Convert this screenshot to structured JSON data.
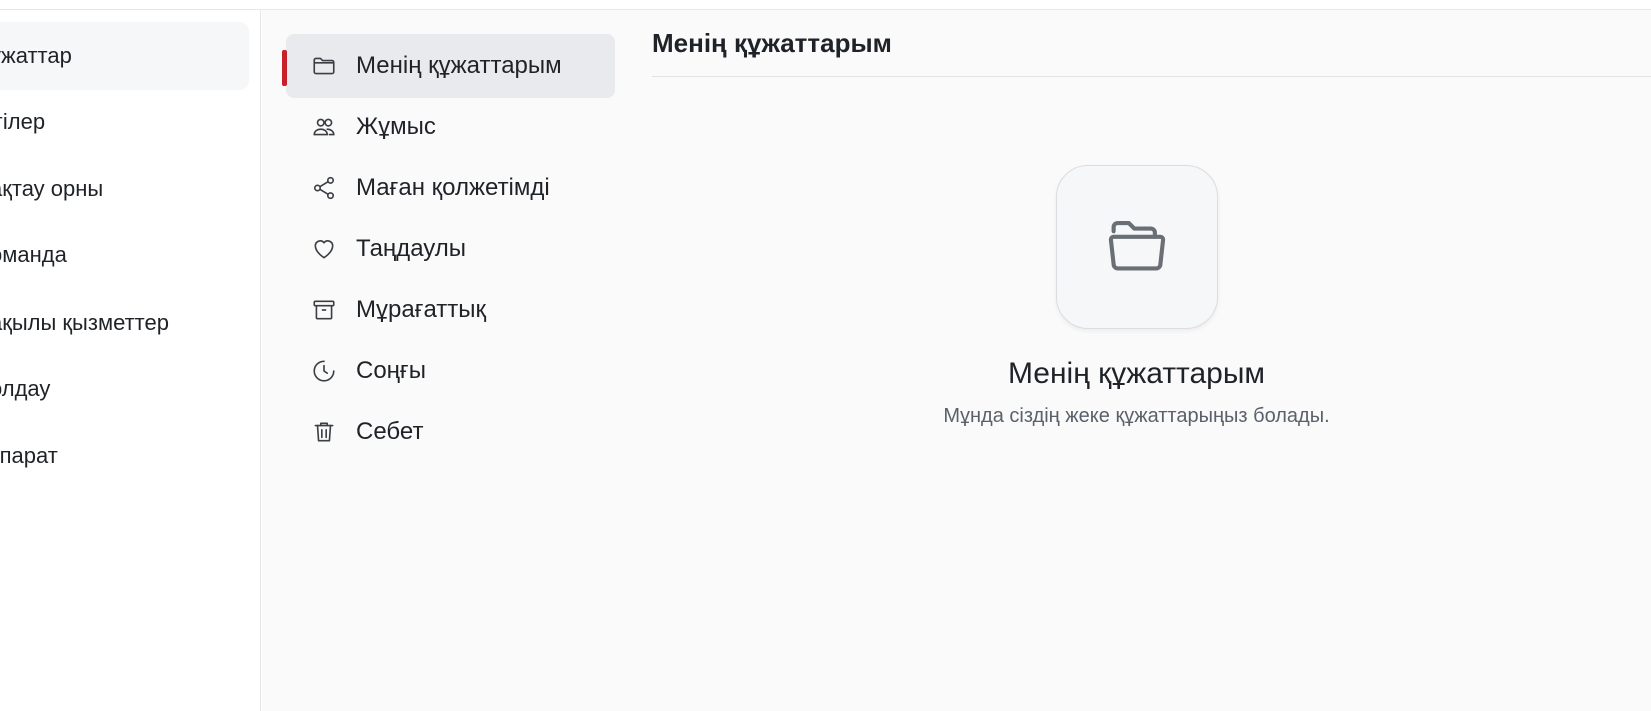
{
  "primary_sidebar": {
    "items": [
      {
        "label": "ұжаттар",
        "active": true
      },
      {
        "label": "ігілер",
        "active": false
      },
      {
        "label": "ақтау орны",
        "active": false
      },
      {
        "label": "оманда",
        "active": false
      },
      {
        "label": "ақылы қызметтер",
        "active": false
      },
      {
        "label": "олдау",
        "active": false
      },
      {
        "label": "қпарат",
        "active": false
      }
    ]
  },
  "secondary_sidebar": {
    "items": [
      {
        "label": "Менің құжаттарым",
        "icon": "folder-icon",
        "active": true
      },
      {
        "label": "Жұмыс",
        "icon": "users-icon",
        "active": false
      },
      {
        "label": "Маған қолжетімді",
        "icon": "share-icon",
        "active": false
      },
      {
        "label": "Таңдаулы",
        "icon": "heart-icon",
        "active": false
      },
      {
        "label": "Мұрағаттық",
        "icon": "archive-icon",
        "active": false
      },
      {
        "label": "Соңғы",
        "icon": "clock-icon",
        "active": false
      },
      {
        "label": "Себет",
        "icon": "trash-icon",
        "active": false
      }
    ]
  },
  "main": {
    "title": "Менің құжаттарым",
    "empty_state": {
      "icon": "open-folder-icon",
      "title": "Менің құжаттарым",
      "description": "Мұнда сіздің жеке құжаттарыңыз болады."
    }
  },
  "colors": {
    "accent": "#c8202a",
    "active_bg": "#e9eaed",
    "text": "#1f2328",
    "muted_text": "#5b616b"
  }
}
